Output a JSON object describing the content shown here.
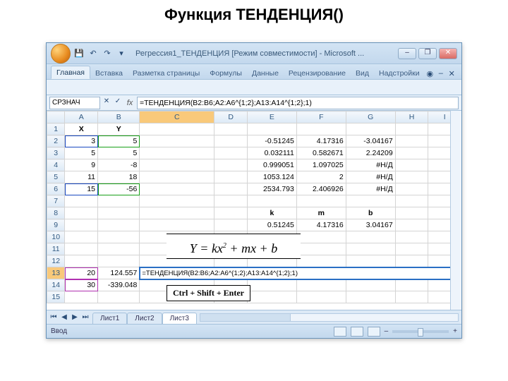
{
  "slide": {
    "title": "Функция ТЕНДЕНЦИЯ()"
  },
  "window": {
    "title": "Регрессия1_ТЕНДЕНЦИЯ  [Режим совместимости]  - Microsoft ..."
  },
  "ribbon": {
    "tabs": [
      "Главная",
      "Вставка",
      "Разметка страницы",
      "Формулы",
      "Данные",
      "Рецензирование",
      "Вид",
      "Надстройки"
    ]
  },
  "formula_bar": {
    "name_box": "СРЗНАЧ",
    "formula": "=ТЕНДЕНЦИЯ(B2:B6;A2:A6^{1;2};A13:A14^{1;2};1)"
  },
  "grid": {
    "cols": [
      "A",
      "B",
      "C",
      "D",
      "E",
      "F",
      "G",
      "H",
      "I"
    ],
    "data": {
      "r1": {
        "A": "X",
        "B": "Y"
      },
      "r2": {
        "A": "3",
        "B": "5",
        "E": "-0.51245",
        "F": "4.17316",
        "G": "-3.04167"
      },
      "r3": {
        "A": "5",
        "B": "5",
        "E": "0.032111",
        "F": "0.582671",
        "G": "2.24209"
      },
      "r4": {
        "A": "9",
        "B": "-8",
        "E": "0.999051",
        "F": "1.097025",
        "G": "#Н/Д"
      },
      "r5": {
        "A": "11",
        "B": "18",
        "E": "1053.124",
        "F": "2",
        "G": "#Н/Д"
      },
      "r6": {
        "A": "15",
        "B": "-56",
        "E": "2534.793",
        "F": "2.406926",
        "G": "#Н/Д"
      },
      "r8": {
        "E": "k",
        "F": "m",
        "G": "b"
      },
      "r9": {
        "E": "0.51245",
        "F": "4.17316",
        "G": "3.04167"
      },
      "r13": {
        "A": "20",
        "B": "124.557",
        "C": "=ТЕНДЕНЦИЯ(B2:B6;A2:A6^{1;2};A13:A14^{1;2};1)"
      },
      "r14": {
        "A": "30",
        "B": "-339.048"
      }
    }
  },
  "overlays": {
    "equation_prefix": "Y = kx",
    "equation_sup": "2",
    "equation_suffix": " + mx + b",
    "shortcut": "Ctrl + Shift + Enter"
  },
  "sheets": [
    "Лист1",
    "Лист2",
    "Лист3"
  ],
  "status": {
    "mode": "Ввод"
  }
}
